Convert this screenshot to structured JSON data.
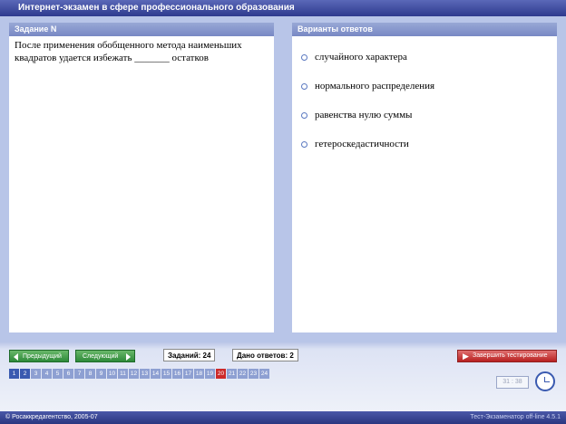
{
  "window": {
    "title": "Интернет-экзамен в сфере профессионального образования"
  },
  "task": {
    "header": "Задание N",
    "question": "После применения обобщенного метода наименьших квадратов удается избежать _______ остатков"
  },
  "answers": {
    "header": "Варианты ответов",
    "options": [
      "случайного характера",
      "нормального распределения",
      "равенства нулю суммы",
      "гетероскедастичности"
    ]
  },
  "nav": {
    "prev_label": "Предыдущий",
    "next_label": "Следующий",
    "tasks_count": "Заданий: 24",
    "answered_count": "Дано ответов: 2",
    "finish_label": "Завершить тестирование"
  },
  "pages": {
    "items": [
      "1",
      "2",
      "3",
      "4",
      "5",
      "6",
      "7",
      "8",
      "9",
      "10",
      "11",
      "12",
      "13",
      "14",
      "15",
      "16",
      "17",
      "18",
      "19",
      "20",
      "21",
      "22",
      "23",
      "24"
    ],
    "current": "20"
  },
  "timer": {
    "value": "31 : 38"
  },
  "status": {
    "left": "© Росаккредагентство, 2005-07",
    "right": "Тест-Экзаменатор off-line 4.5.1"
  },
  "colors": {
    "title_bar": "#2e3a8e",
    "panel_header": "#8898cc",
    "nav_button": "#2e8a3a",
    "finish_button": "#b82020",
    "page_current": "#cc2a2a"
  },
  "icons": [
    "arrow-left-icon",
    "arrow-right-icon",
    "runner-icon",
    "clock-icon",
    "copyright-icon"
  ]
}
